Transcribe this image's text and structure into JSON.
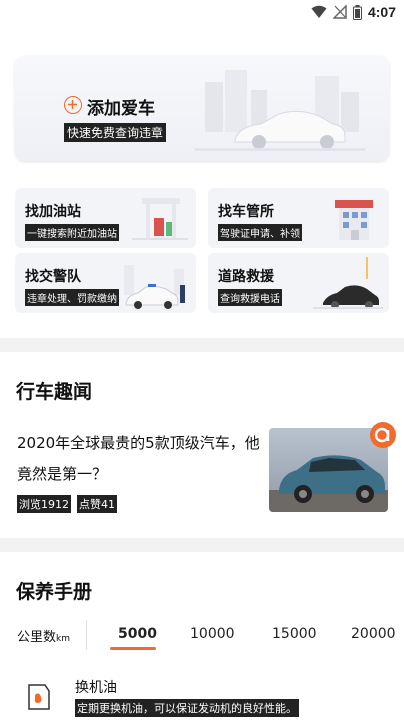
{
  "status_bar": {
    "time": "4:07"
  },
  "add_car": {
    "title": "添加爱车",
    "subtitle": "快速免费查询违章"
  },
  "services": [
    {
      "title": "找加油站",
      "subtitle": "一键搜索附近加油站"
    },
    {
      "title": "找车管所",
      "subtitle": "驾驶证申请、补领"
    },
    {
      "title": "找交警队",
      "subtitle": "违章处理、罚款缴纳"
    },
    {
      "title": "道路救援",
      "subtitle": "查询救援电话"
    }
  ],
  "news": {
    "section_title": "行车趣闻",
    "headline": "2020年全球最贵的5款顶级汽车，他竟然是第一？",
    "views": "浏览1912",
    "likes": "点赞41"
  },
  "maintenance": {
    "section_title": "保养手册",
    "km_label": "公里数",
    "km_unit": "km",
    "tabs": [
      "5000",
      "10000",
      "15000",
      "20000"
    ],
    "active_tab": "5000",
    "items": [
      {
        "title": "换机油",
        "desc": "定期更换机油，可以保证发动机的良好性能。"
      }
    ]
  },
  "colors": {
    "accent": "#f26a2e",
    "divider": "#f2f2f2",
    "card": "#f3f4f7"
  }
}
